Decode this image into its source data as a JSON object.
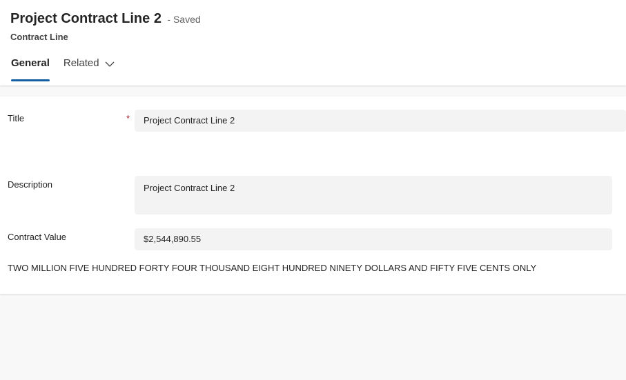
{
  "header": {
    "title": "Project Contract Line 2",
    "save_status": "- Saved",
    "entity_type": "Contract Line"
  },
  "tabs": [
    {
      "label": "General",
      "active": true
    },
    {
      "label": "Related",
      "active": false,
      "icon": "chevron-down-icon"
    }
  ],
  "form": {
    "title": {
      "label": "Title",
      "required_marker": "*",
      "value": "Project Contract Line 2"
    },
    "description": {
      "label": "Description",
      "value": "Project Contract Line 2"
    },
    "contract_value": {
      "label": "Contract Value",
      "value": "$2,544,890.55"
    },
    "amount_in_words": "TWO MILLION FIVE HUNDRED FORTY FOUR THOUSAND EIGHT HUNDRED NINETY DOLLARS AND FIFTY FIVE CENTS ONLY"
  },
  "colors": {
    "accent": "#115ea3",
    "required": "#a4262c",
    "input_background": "#f3f3f3",
    "page_background": "#f8f8f8"
  }
}
